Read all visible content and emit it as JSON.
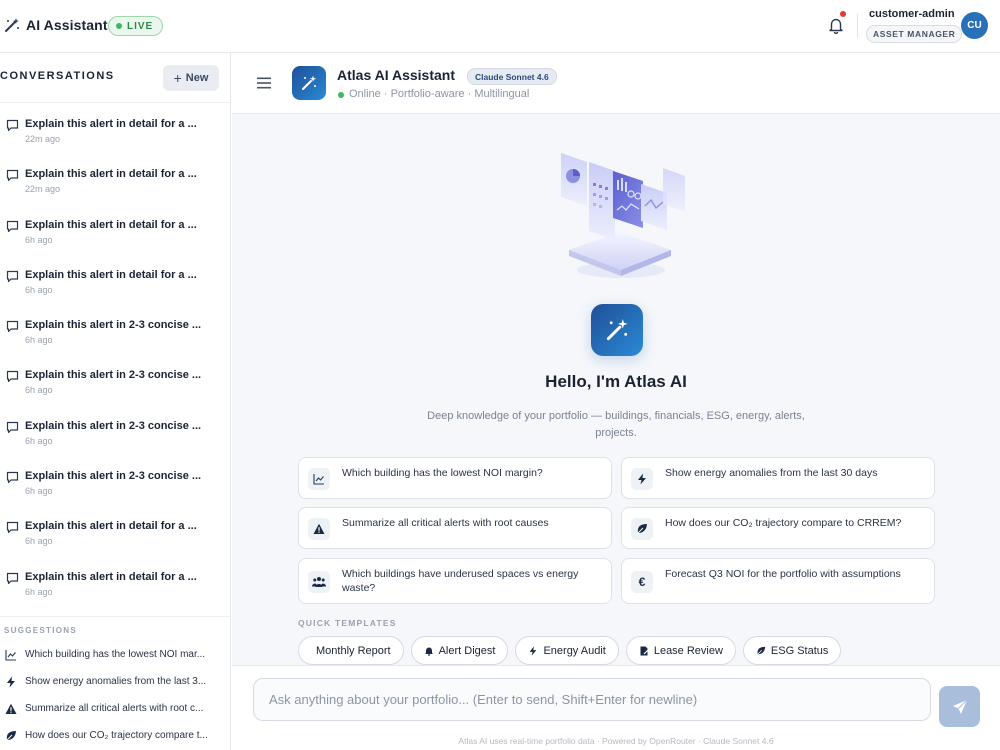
{
  "topbar": {
    "title": "AI Assistant",
    "live": "LIVE",
    "user_name": "customer-admin",
    "role": "ASSET MANAGER",
    "avatar": "CU",
    "icons": {
      "brand": "magic-wand-icon",
      "bell": "bell-icon"
    }
  },
  "sidebar": {
    "header": "CONVERSATIONS",
    "new_button": "New",
    "conversations": [
      {
        "title": "Explain this alert in detail for a ...",
        "time": "22m ago"
      },
      {
        "title": "Explain this alert in detail for a ...",
        "time": "22m ago"
      },
      {
        "title": "Explain this alert in detail for a ...",
        "time": "6h ago"
      },
      {
        "title": "Explain this alert in detail for a ...",
        "time": "6h ago"
      },
      {
        "title": "Explain this alert in 2-3 concise ...",
        "time": "6h ago"
      },
      {
        "title": "Explain this alert in 2-3 concise ...",
        "time": "6h ago"
      },
      {
        "title": "Explain this alert in 2-3 concise ...",
        "time": "6h ago"
      },
      {
        "title": "Explain this alert in 2-3 concise ...",
        "time": "6h ago"
      },
      {
        "title": "Explain this alert in detail for a ...",
        "time": "6h ago"
      },
      {
        "title": "Explain this alert in detail for a ...",
        "time": "6h ago"
      }
    ],
    "suggestions_header": "SUGGESTIONS",
    "suggestions": [
      {
        "text": "Which building has the lowest NOI mar...",
        "icon": "chart-line-icon"
      },
      {
        "text": "Show energy anomalies from the last 3...",
        "icon": "lightning-icon"
      },
      {
        "text": "Summarize all critical alerts with root c...",
        "icon": "warning-icon"
      },
      {
        "text": "How does our CO₂ trajectory compare t...",
        "icon": "leaf-icon"
      }
    ]
  },
  "header": {
    "title": "Atlas AI Assistant",
    "model": "Claude Sonnet 4.6",
    "status": "Online · Portfolio-aware · Multilingual"
  },
  "hero": {
    "title": "Hello, I'm Atlas AI",
    "subtitle": "Deep knowledge of your portfolio — buildings, financials, ESG, energy, alerts, projects."
  },
  "prompts": [
    {
      "text": "Which building has the lowest NOI margin?",
      "icon": "chart-line-icon"
    },
    {
      "text": "Show energy anomalies from the last 30 days",
      "icon": "lightning-icon"
    },
    {
      "text": "Summarize all critical alerts with root causes",
      "icon": "warning-icon"
    },
    {
      "text": "How does our CO₂ trajectory compare to CRREM?",
      "icon": "leaf-icon"
    },
    {
      "text": "Which buildings have underused spaces vs energy waste?",
      "icon": "people-icon"
    },
    {
      "text": "Forecast Q3 NOI for the portfolio with assumptions",
      "icon": "euro-icon"
    }
  ],
  "quick_templates": {
    "label": "QUICK TEMPLATES",
    "items": [
      {
        "label": "Monthly Report",
        "icon": ""
      },
      {
        "label": "Alert Digest",
        "icon": "bell-icon"
      },
      {
        "label": "Energy Audit",
        "icon": "lightning-icon"
      },
      {
        "label": "Lease Review",
        "icon": "document-icon"
      },
      {
        "label": "ESG Status",
        "icon": "leaf-icon"
      }
    ]
  },
  "composer": {
    "placeholder": "Ask anything about your portfolio... (Enter to send, Shift+Enter for newline)",
    "footer": "Atlas AI uses real-time portfolio data · Powered by OpenRouter · Claude Sonnet 4.6"
  },
  "colors": {
    "accent": "#2870b8",
    "live_green": "#3dba61",
    "alert_red": "#e53935",
    "send_disabled": "#a9bedb"
  }
}
